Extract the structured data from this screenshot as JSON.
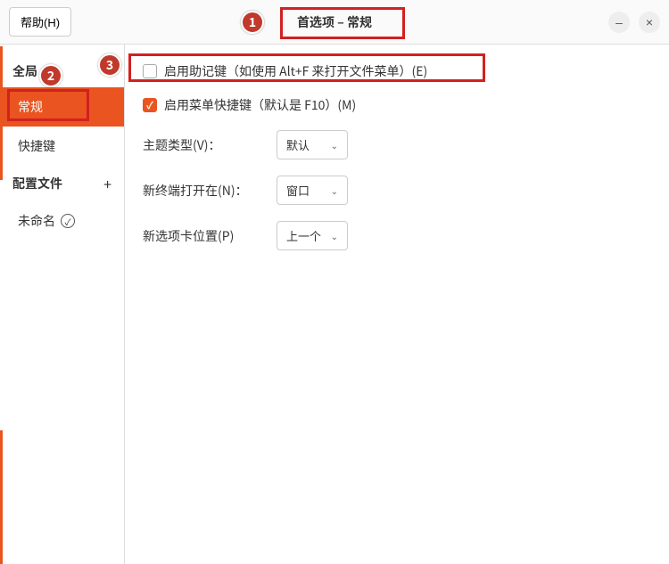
{
  "titlebar": {
    "help_label": "帮助(H)",
    "title": "首选项 – 常规"
  },
  "sidebar": {
    "global_label": "全局",
    "items": [
      "常规",
      "快捷键"
    ],
    "profiles_label": "配置文件",
    "profiles": [
      "未命名"
    ]
  },
  "main": {
    "mnemonics_label": "启用助记键（如使用 Alt+F 来打开文件菜单）(E)",
    "accel_label": "启用菜单快捷键（默认是 F10）(M)",
    "theme_label": "主题类型(V)：",
    "theme_value": "默认",
    "newterm_label": "新终端打开在(N)：",
    "newterm_value": "窗口",
    "newtab_label": "新选项卡位置(P)",
    "newtab_value": "上一个"
  },
  "annotations": {
    "m1": "1",
    "m2": "2",
    "m3": "3"
  }
}
